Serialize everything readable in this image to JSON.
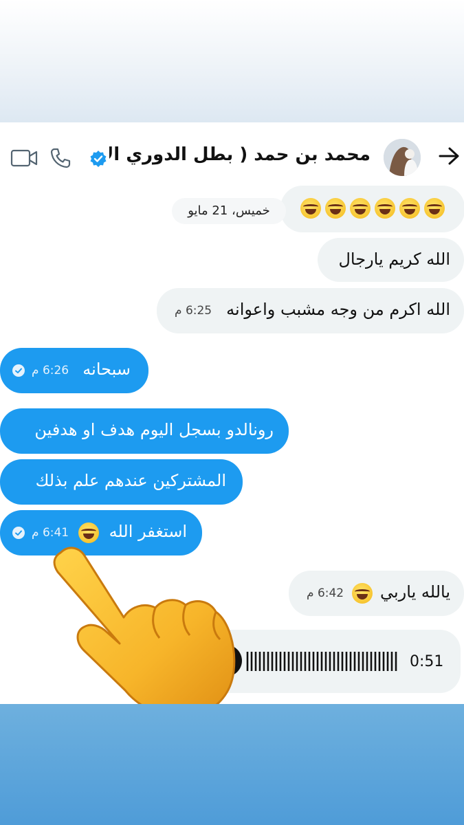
{
  "header": {
    "contact_name": "محمد بن حمد ( بطل الدوري الأق...",
    "icons": [
      "back-arrow-icon",
      "verified-badge-icon",
      "phone-icon",
      "video-call-icon"
    ]
  },
  "date_separator": "خميس، 21 مايو",
  "messages": [
    {
      "side": "received",
      "text": "😂😂😂😂😂😂",
      "time": ""
    },
    {
      "side": "received",
      "text": "الله كريم يارجال",
      "time": ""
    },
    {
      "side": "received",
      "text": "الله اكرم من وجه مشبب واعوانه",
      "time": "6:25 م"
    },
    {
      "side": "sent",
      "text": "سبحانه",
      "time": "6:26 م",
      "read": true
    },
    {
      "side": "sent",
      "text": "رونالدو بسجل اليوم هدف او هدفين",
      "time": ""
    },
    {
      "side": "sent",
      "text": "المشتركين عندهم علم بذلك",
      "time": ""
    },
    {
      "side": "sent",
      "text": "استغفر الله",
      "time": "6:41 م",
      "read": true
    },
    {
      "side": "received",
      "text": "يالله ياربي",
      "time": "6:42 م"
    }
  ],
  "voice_message": {
    "duration": "0:51"
  },
  "colors": {
    "sent_bubble": "#1d9bf0",
    "received_bubble": "#eff3f4",
    "bottom_band": "#4f9cd8"
  }
}
